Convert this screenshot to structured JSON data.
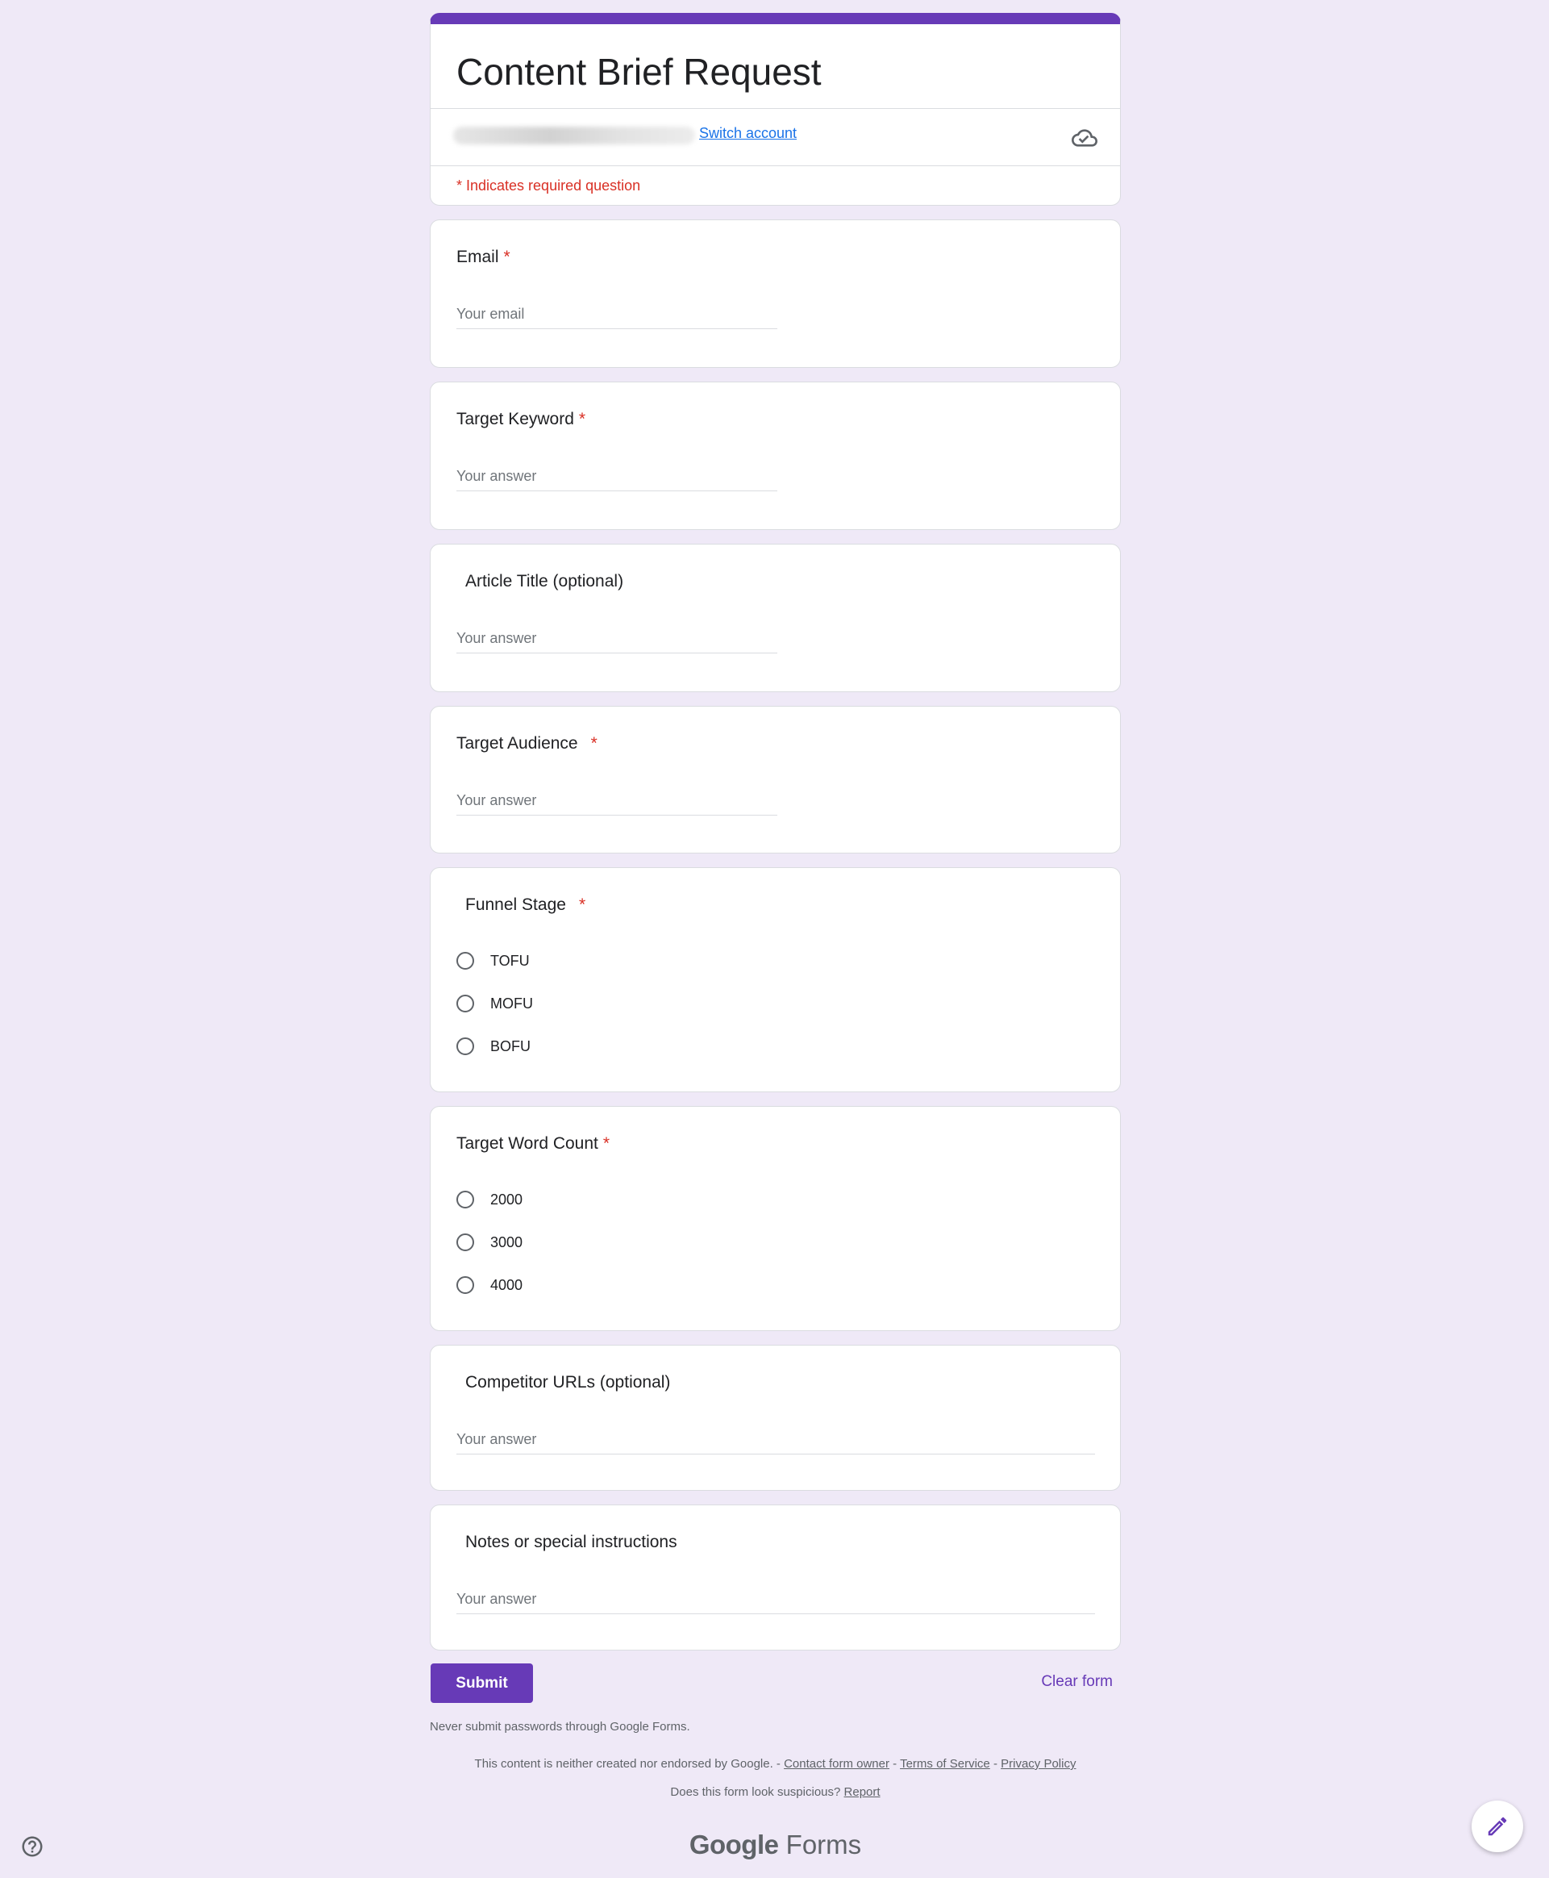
{
  "header": {
    "title": "Content Brief Request",
    "switch_account": "Switch account",
    "required_note": "* Indicates required question"
  },
  "questions": [
    {
      "title": "Email",
      "required": "*",
      "placeholder": "Your email"
    },
    {
      "title": "Target Keyword",
      "required": "*",
      "placeholder": "Your answer"
    },
    {
      "title": "Article Title (optional)",
      "placeholder": "Your answer"
    },
    {
      "title": "Target Audience",
      "required": "*",
      "placeholder": "Your answer"
    },
    {
      "title": "Funnel Stage",
      "required": "*",
      "options": [
        "TOFU",
        "MOFU",
        "BOFU"
      ]
    },
    {
      "title": "Target Word Count",
      "required": "*",
      "options": [
        "2000",
        "3000",
        "4000"
      ]
    },
    {
      "title": "Competitor URLs (optional)",
      "placeholder": "Your answer"
    },
    {
      "title": "Notes or special instructions",
      "placeholder": "Your answer"
    }
  ],
  "actions": {
    "submit": "Submit",
    "clear": "Clear form"
  },
  "footer": {
    "password_warning": "Never submit passwords through Google Forms.",
    "disclaimer_text": "This content is neither created nor endorsed by Google. -",
    "contact_owner": "Contact form owner",
    "sep1": "-",
    "terms": "Terms of Service",
    "sep2": "-",
    "privacy": "Privacy Policy",
    "suspicious_text": "Does this form look suspicious?",
    "report": "Report",
    "brand_google": "Google",
    "brand_forms": "Forms"
  },
  "icons": {
    "cloud": "cloud-check-icon",
    "help": "help-icon",
    "edit": "pencil-icon"
  },
  "colors": {
    "accent": "#673ab7",
    "required": "#d93025",
    "link": "#1a73e8",
    "background": "#efe9f7"
  }
}
